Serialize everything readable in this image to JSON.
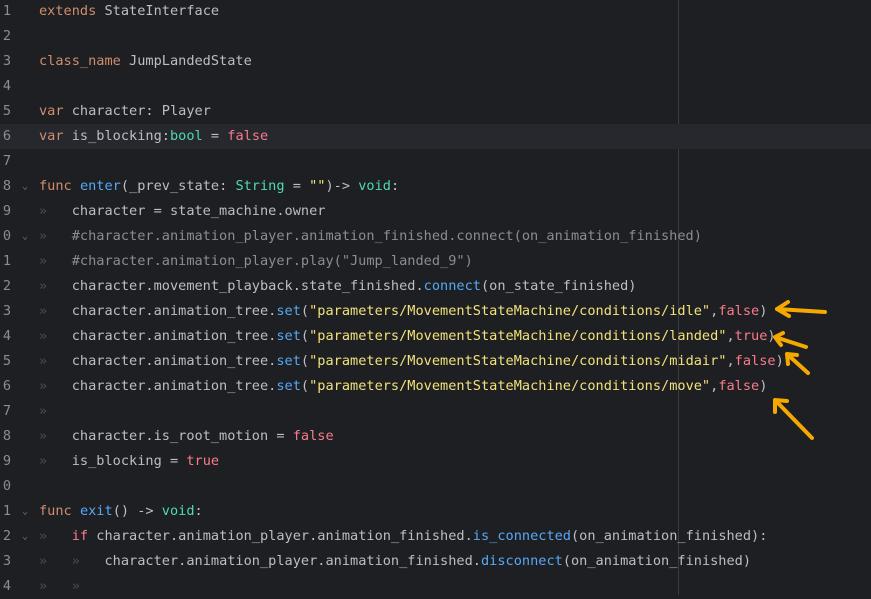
{
  "editor": {
    "lines": [
      {
        "num": "1",
        "fold": "",
        "current": false,
        "tokens": [
          [
            "kw",
            "extends"
          ],
          [
            "id",
            " StateInterface"
          ]
        ]
      },
      {
        "num": "2",
        "fold": "",
        "current": false,
        "tokens": []
      },
      {
        "num": "3",
        "fold": "",
        "current": false,
        "tokens": [
          [
            "kw",
            "class_name"
          ],
          [
            "id",
            " JumpLandedState"
          ]
        ]
      },
      {
        "num": "4",
        "fold": "",
        "current": false,
        "tokens": []
      },
      {
        "num": "5",
        "fold": "",
        "current": false,
        "tokens": [
          [
            "kw",
            "var"
          ],
          [
            "id",
            " character: Player"
          ]
        ]
      },
      {
        "num": "6",
        "fold": "",
        "current": true,
        "tokens": [
          [
            "kw",
            "var"
          ],
          [
            "id",
            " is_blocking:"
          ],
          [
            "type",
            "bool"
          ],
          [
            "id",
            " = "
          ],
          [
            "bool",
            "false"
          ]
        ]
      },
      {
        "num": "7",
        "fold": "",
        "current": false,
        "tokens": []
      },
      {
        "num": "8",
        "fold": "v",
        "current": false,
        "tokens": [
          [
            "kw",
            "func"
          ],
          [
            "id",
            " "
          ],
          [
            "func",
            "enter"
          ],
          [
            "id",
            "(_prev_state: "
          ],
          [
            "type",
            "String"
          ],
          [
            "id",
            " = "
          ],
          [
            "str",
            "\"\""
          ],
          [
            "id",
            ")-> "
          ],
          [
            "type",
            "void"
          ],
          [
            "id",
            ":"
          ]
        ]
      },
      {
        "num": "9",
        "fold": "",
        "current": false,
        "tokens": [
          [
            "guide",
            "»"
          ],
          [
            "id",
            "   character = state_machine.owner"
          ]
        ]
      },
      {
        "num": "0",
        "fold": "v",
        "current": false,
        "tokens": [
          [
            "guide",
            "»"
          ],
          [
            "com",
            "   #character.animation_player.animation_finished.connect(on_animation_finished)"
          ]
        ]
      },
      {
        "num": "1",
        "fold": "",
        "current": false,
        "tokens": [
          [
            "guide",
            "»"
          ],
          [
            "com",
            "   #character.animation_player.play(\"Jump_landed_9\")"
          ]
        ]
      },
      {
        "num": "2",
        "fold": "",
        "current": false,
        "tokens": [
          [
            "guide",
            "»"
          ],
          [
            "id",
            "   character.movement_playback.state_finished."
          ],
          [
            "func",
            "connect"
          ],
          [
            "id",
            "(on_state_finished)"
          ]
        ]
      },
      {
        "num": "3",
        "fold": "",
        "current": false,
        "tokens": [
          [
            "guide",
            "»"
          ],
          [
            "id",
            "   character.animation_tree."
          ],
          [
            "func",
            "set"
          ],
          [
            "id",
            "("
          ],
          [
            "str",
            "\"parameters/MovementStateMachine/conditions/idle\""
          ],
          [
            "id",
            ","
          ],
          [
            "bool",
            "false"
          ],
          [
            "id",
            ")"
          ]
        ]
      },
      {
        "num": "4",
        "fold": "",
        "current": false,
        "tokens": [
          [
            "guide",
            "»"
          ],
          [
            "id",
            "   character.animation_tree."
          ],
          [
            "func",
            "set"
          ],
          [
            "id",
            "("
          ],
          [
            "str",
            "\"parameters/MovementStateMachine/conditions/landed\""
          ],
          [
            "id",
            ","
          ],
          [
            "bool",
            "true"
          ],
          [
            "id",
            ")"
          ]
        ]
      },
      {
        "num": "5",
        "fold": "",
        "current": false,
        "tokens": [
          [
            "guide",
            "»"
          ],
          [
            "id",
            "   character.animation_tree."
          ],
          [
            "func",
            "set"
          ],
          [
            "id",
            "("
          ],
          [
            "str",
            "\"parameters/MovementStateMachine/conditions/midair\""
          ],
          [
            "id",
            ","
          ],
          [
            "bool",
            "false"
          ],
          [
            "id",
            ")"
          ]
        ]
      },
      {
        "num": "6",
        "fold": "",
        "current": false,
        "tokens": [
          [
            "guide",
            "»"
          ],
          [
            "id",
            "   character.animation_tree."
          ],
          [
            "func",
            "set"
          ],
          [
            "id",
            "("
          ],
          [
            "str",
            "\"parameters/MovementStateMachine/conditions/move\""
          ],
          [
            "id",
            ","
          ],
          [
            "bool",
            "false"
          ],
          [
            "id",
            ")"
          ]
        ]
      },
      {
        "num": "7",
        "fold": "",
        "current": false,
        "tokens": [
          [
            "guide",
            "»"
          ]
        ]
      },
      {
        "num": "8",
        "fold": "",
        "current": false,
        "tokens": [
          [
            "guide",
            "»"
          ],
          [
            "id",
            "   character.is_root_motion = "
          ],
          [
            "bool",
            "false"
          ]
        ]
      },
      {
        "num": "9",
        "fold": "",
        "current": false,
        "tokens": [
          [
            "guide",
            "»"
          ],
          [
            "id",
            "   is_blocking = "
          ],
          [
            "bool",
            "true"
          ]
        ]
      },
      {
        "num": "0",
        "fold": "",
        "current": false,
        "tokens": []
      },
      {
        "num": "1",
        "fold": "v",
        "current": false,
        "tokens": [
          [
            "kw",
            "func"
          ],
          [
            "id",
            " "
          ],
          [
            "func",
            "exit"
          ],
          [
            "id",
            "() -> "
          ],
          [
            "type",
            "void"
          ],
          [
            "id",
            ":"
          ]
        ]
      },
      {
        "num": "2",
        "fold": "v",
        "current": false,
        "tokens": [
          [
            "guide",
            "»"
          ],
          [
            "id",
            "   "
          ],
          [
            "kw2",
            "if"
          ],
          [
            "id",
            " character.animation_player.animation_finished."
          ],
          [
            "func",
            "is_connected"
          ],
          [
            "id",
            "(on_animation_finished):"
          ]
        ]
      },
      {
        "num": "3",
        "fold": "",
        "current": false,
        "tokens": [
          [
            "guide",
            "»"
          ],
          [
            "id",
            "   "
          ],
          [
            "guide",
            "»"
          ],
          [
            "id",
            "   character.animation_player.animation_finished."
          ],
          [
            "func",
            "disconnect"
          ],
          [
            "id",
            "(on_animation_finished)"
          ]
        ]
      },
      {
        "num": "4",
        "fold": "",
        "current": false,
        "tokens": [
          [
            "guide",
            "»"
          ],
          [
            "id",
            "   "
          ],
          [
            "guide",
            "»"
          ]
        ]
      }
    ],
    "icons": {
      "fold": "chevron-down-icon",
      "indent": "tab-indent-guide-icon"
    },
    "colors": {
      "background": "#1e1f22",
      "current_line": "#26282e",
      "keyword": "#cf8e6d",
      "type": "#4ed9b4",
      "function": "#56a8f5",
      "string": "#f1e27a",
      "bool": "#fa7b8a",
      "comment": "#8b8d94",
      "annotation_arrow": "#f5a800"
    }
  }
}
